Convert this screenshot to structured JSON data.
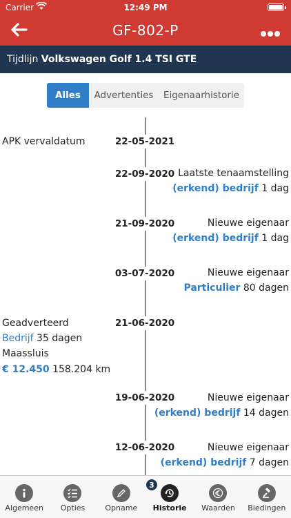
{
  "status_bar": {
    "carrier": "Carrier",
    "time": "12:49 PM"
  },
  "nav": {
    "title": "GF-802-P"
  },
  "subheader": {
    "prefix": "Tijdlijn",
    "model": "Volkswagen Golf 1.4 TSI GTE"
  },
  "segments": [
    {
      "label": "Alles",
      "active": true
    },
    {
      "label": "Advertenties",
      "active": false
    },
    {
      "label": "Eigenaarhistorie",
      "active": false
    }
  ],
  "timeline": [
    {
      "date": "22-05-2021",
      "left_title": "APK vervaldatum"
    },
    {
      "date": "22-09-2020",
      "title": "Laatste tenaamstelling",
      "link": "(erkend) bedrijf",
      "duration": "1 dag"
    },
    {
      "date": "21-09-2020",
      "title": "Nieuwe eigenaar",
      "link": "(erkend) bedrijf",
      "duration": "1 dag"
    },
    {
      "date": "03-07-2020",
      "title": "Nieuwe eigenaar",
      "link": "Particulier",
      "duration": "80 dagen"
    },
    {
      "date": "21-06-2020",
      "ad": {
        "title": "Geadverteerd",
        "link": "Bedrijf",
        "duration": "35 dagen",
        "location": "Maassluis",
        "price": "€ 12.450",
        "mileage": "158.204 km"
      }
    },
    {
      "date": "19-06-2020",
      "title": "Nieuwe eigenaar",
      "link": "(erkend) bedrijf",
      "duration": "14 dagen"
    },
    {
      "date": "12-06-2020",
      "title": "Nieuwe eigenaar",
      "link": "(erkend) bedrijf",
      "duration": "7 dagen"
    }
  ],
  "tabbar": {
    "badge": "3",
    "tabs": [
      {
        "label": "Algemeen",
        "icon": "info-icon"
      },
      {
        "label": "Opties",
        "icon": "checklist-icon"
      },
      {
        "label": "Opname",
        "icon": "pencil-icon"
      },
      {
        "label": "Historie",
        "icon": "history-icon",
        "active": true
      },
      {
        "label": "Waarden",
        "icon": "euro-icon"
      },
      {
        "label": "Biedingen",
        "icon": "gavel-icon"
      }
    ]
  }
}
